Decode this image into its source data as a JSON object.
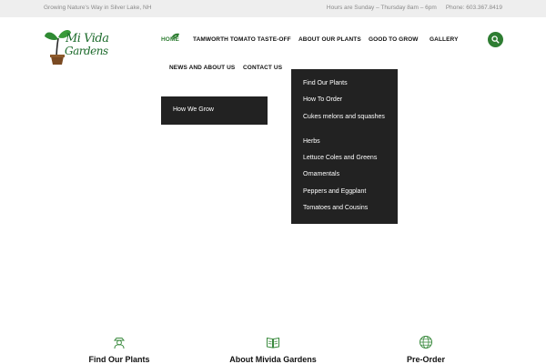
{
  "topbar": {
    "tagline": "Growing Nature's Way in Silver Lake, NH",
    "hours": "Hours are Sunday – Thursday 8am – 6pm",
    "phone": "Phone: 603.367.8419"
  },
  "logo": {
    "line1": "Mi Vida",
    "line2": "Gardens"
  },
  "nav": {
    "home": "HOME",
    "tamworth": "TAMWORTH TOMATO TASTE-OFF",
    "about_plants": "ABOUT OUR PLANTS",
    "good_to_grow": "GOOD TO GROW",
    "gallery": "GALLERY",
    "news": "NEWS AND ABOUT US",
    "contact": "CONTACT US"
  },
  "dropdown_grow": {
    "items": [
      "How We Grow"
    ]
  },
  "dropdown_plants": {
    "items": [
      "Find Our Plants",
      "How To Order",
      "Cukes melons and squashes",
      "Herbs",
      "Lettuce Coles and Greens",
      "Ornamentals",
      "Peppers and Eggplant",
      "Tomatoes and Cousins"
    ]
  },
  "features": [
    {
      "title": "Find Our Plants",
      "icon": "gardener-icon"
    },
    {
      "title": "About Mivida Gardens",
      "icon": "book-icon"
    },
    {
      "title": "Pre-Order",
      "icon": "globe-icon"
    }
  ],
  "colors": {
    "accent": "#2e7d32",
    "dropdown_bg": "#222222",
    "topbar_bg": "#eeeeee"
  }
}
